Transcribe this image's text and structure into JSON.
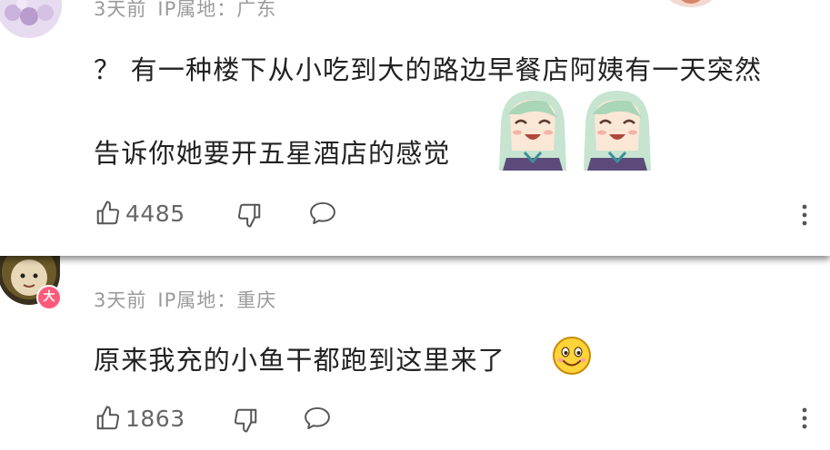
{
  "comments": [
    {
      "time": "3天前",
      "location": "IP属地：广东",
      "text_line1": "？ 有一种楼下从小吃到大的路边早餐店阿姨有一天突然",
      "text_line2": "告诉你她要开五星酒店的感觉",
      "likes": "4485",
      "stickers": [
        "sticker-anime-girl-laughing",
        "sticker-anime-girl-laughing"
      ]
    },
    {
      "time": "3天前",
      "location": "IP属地：重庆",
      "avatar_badge": "大",
      "text": "原来我充的小鱼干都跑到这里来了",
      "emoji": "smile-emoji",
      "likes": "1863"
    }
  ],
  "icons": [
    "thumbs-up-icon",
    "thumbs-down-icon",
    "comment-bubble-icon",
    "more-vertical-icon"
  ],
  "colors": {
    "meta_text": "#9a9a9a",
    "body_text": "#222222",
    "badge": "#ff5a7a",
    "emoji": "#ffd43b"
  }
}
